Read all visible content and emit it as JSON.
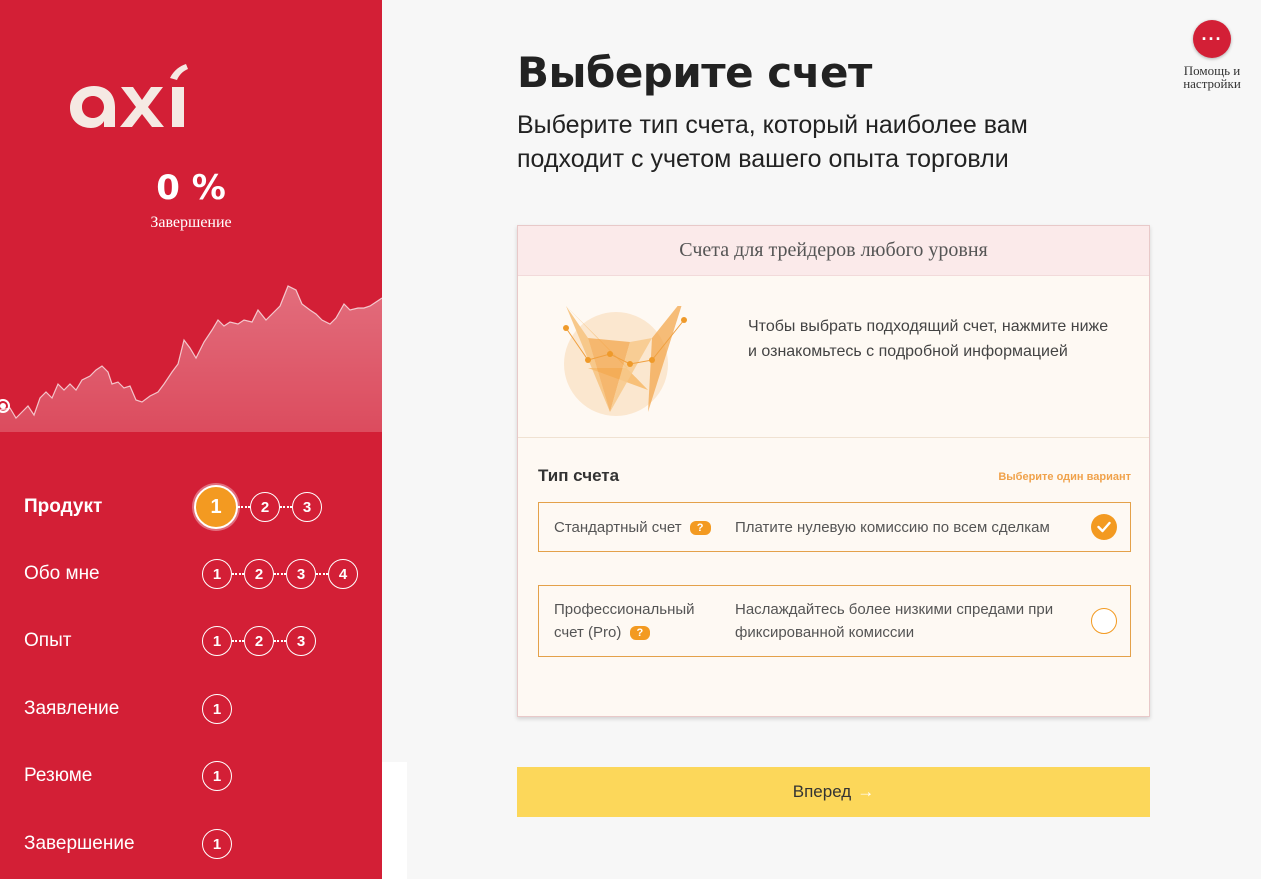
{
  "brand": {
    "logo_text": "axi"
  },
  "progress": {
    "percent": "0 %",
    "label": "Завершение"
  },
  "sidebar": {
    "steps": [
      {
        "name": "Продукт",
        "dots": [
          "1",
          "2",
          "3"
        ],
        "active": true
      },
      {
        "name": "Обо мне",
        "dots": [
          "1",
          "2",
          "3",
          "4"
        ]
      },
      {
        "name": "Опыт",
        "dots": [
          "1",
          "2",
          "3"
        ]
      },
      {
        "name": "Заявление",
        "dots": [
          "1"
        ]
      },
      {
        "name": "Резюме",
        "dots": [
          "1"
        ]
      },
      {
        "name": "Завершение",
        "dots": [
          "1"
        ]
      }
    ]
  },
  "help": {
    "button_icon": "···",
    "label": "Помощь и настройки"
  },
  "main": {
    "title": "Выберите счет",
    "subtitle": "Выберите тип счета, который наиболее вам подходит с учетом вашего опыта торговли"
  },
  "card": {
    "header": "Счета для трейдеров любого уровня",
    "intro": "Чтобы выбрать подходящий счет, нажмите ниже и ознакомьтесь с подробной информацией",
    "type_label": "Тип счета",
    "choose_hint": "Выберите один вариант",
    "options": [
      {
        "name": "Стандартный счет",
        "help_badge": "?",
        "description": "Платите нулевую комиссию по всем сделкам",
        "selected": true
      },
      {
        "name": "Профессиональный счет (Pro)",
        "help_badge": "?",
        "description": "Наслаждайтесь более низкими спредами при фиксированной комиссии",
        "selected": false
      }
    ]
  },
  "next_button": {
    "label": "Вперед",
    "arrow": "→"
  },
  "colors": {
    "brand_red": "#d31f36",
    "accent_orange": "#f39a21",
    "button_yellow": "#fcd75a"
  }
}
